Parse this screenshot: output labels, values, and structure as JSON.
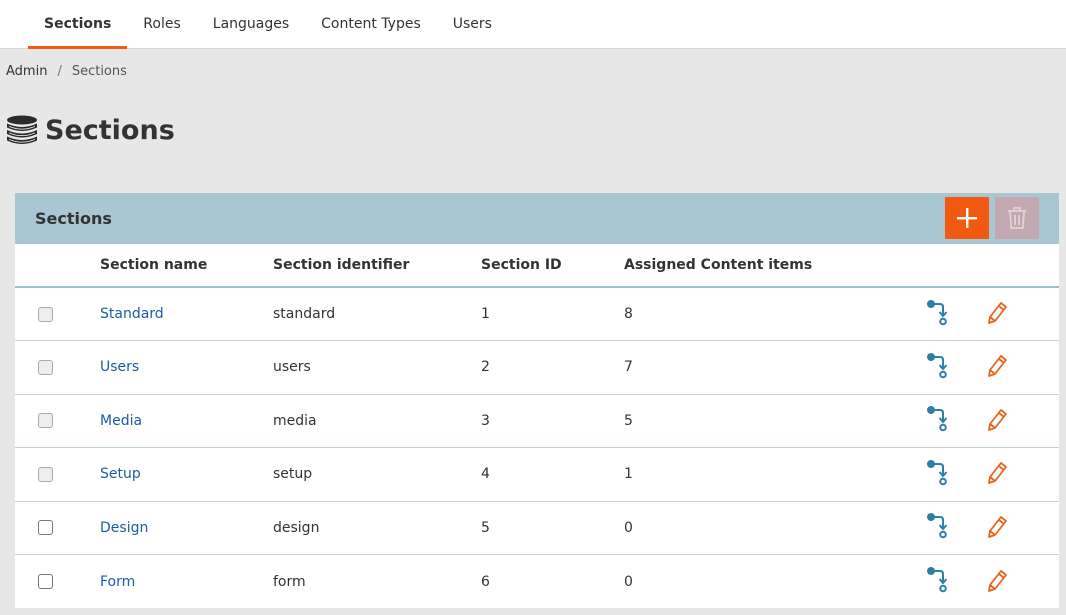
{
  "tabs": [
    {
      "label": "Sections",
      "active": true
    },
    {
      "label": "Roles"
    },
    {
      "label": "Languages"
    },
    {
      "label": "Content Types"
    },
    {
      "label": "Users"
    }
  ],
  "breadcrumb": {
    "admin": "Admin",
    "separator": "/",
    "current": "Sections"
  },
  "page": {
    "title": "Sections",
    "icon": "database-icon"
  },
  "panel": {
    "title": "Sections",
    "add_icon": "plus-icon",
    "delete_icon": "trash-icon"
  },
  "table": {
    "headers": [
      "",
      "Section name",
      "Section identifier",
      "Section ID",
      "Assigned Content items"
    ],
    "rows": [
      {
        "name": "Standard",
        "identifier": "standard",
        "id": "1",
        "items": "8",
        "checkbox_enabled": false
      },
      {
        "name": "Users",
        "identifier": "users",
        "id": "2",
        "items": "7",
        "checkbox_enabled": false
      },
      {
        "name": "Media",
        "identifier": "media",
        "id": "3",
        "items": "5",
        "checkbox_enabled": false
      },
      {
        "name": "Setup",
        "identifier": "setup",
        "id": "4",
        "items": "1",
        "checkbox_enabled": false
      },
      {
        "name": "Design",
        "identifier": "design",
        "id": "5",
        "items": "0",
        "checkbox_enabled": true
      },
      {
        "name": "Form",
        "identifier": "form",
        "id": "6",
        "items": "0",
        "checkbox_enabled": true
      }
    ]
  },
  "colors": {
    "accent": "#f15a10",
    "panel_header": "#a8c7d3",
    "link": "#1f5aa6",
    "assign_icon": "#2e7fa6",
    "edit_icon": "#e4661e"
  }
}
